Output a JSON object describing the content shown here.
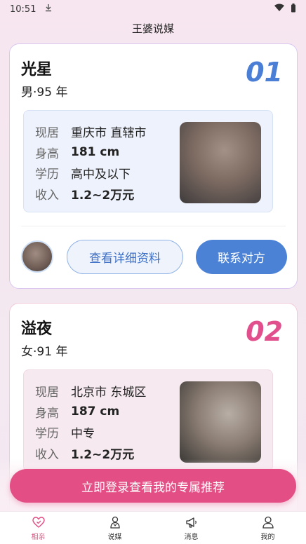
{
  "status": {
    "time": "10:51"
  },
  "app_title": "王婆说媒",
  "cards": [
    {
      "name": "光星",
      "meta": "男·95 年",
      "number": "01",
      "fields": [
        {
          "label": "现居",
          "value": "重庆市 直辖市"
        },
        {
          "label": "身高",
          "value": "181 cm"
        },
        {
          "label": "学历",
          "value": "高中及以下"
        },
        {
          "label": "收入",
          "value": "1.2~2万元"
        }
      ],
      "detail_button": "查看详细资料",
      "contact_button": "联系对方"
    },
    {
      "name": "溢夜",
      "meta": "女·91 年",
      "number": "02",
      "fields": [
        {
          "label": "现居",
          "value": "北京市 东城区"
        },
        {
          "label": "身高",
          "value": "187 cm"
        },
        {
          "label": "学历",
          "value": "中专"
        },
        {
          "label": "收入",
          "value": "1.2~2万元"
        }
      ]
    }
  ],
  "login_cta": "立即登录查看我的专属推荐",
  "tabs": [
    {
      "label": "相亲",
      "icon": "heart-icon",
      "active": true
    },
    {
      "label": "说媒",
      "icon": "matchmaker-icon",
      "active": false
    },
    {
      "label": "消息",
      "icon": "megaphone-icon",
      "active": false
    },
    {
      "label": "我的",
      "icon": "person-icon",
      "active": false
    }
  ],
  "colors": {
    "accent_pink": "#e34e84",
    "accent_blue": "#4c82d6"
  }
}
